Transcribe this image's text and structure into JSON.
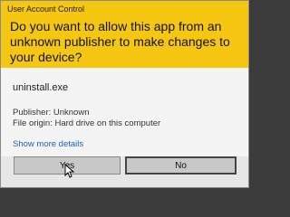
{
  "dialog": {
    "title": "User Account Control",
    "question": "Do you want to allow this app from an unknown publisher to make changes to your device?",
    "app_name": "uninstall.exe",
    "publisher": "Publisher: Unknown",
    "file_origin": "File origin: Hard drive on this computer",
    "show_more": "Show more details",
    "yes_label": "Yes",
    "no_label": "No"
  },
  "colors": {
    "header": "#f6c712",
    "link": "#1a62c8"
  }
}
